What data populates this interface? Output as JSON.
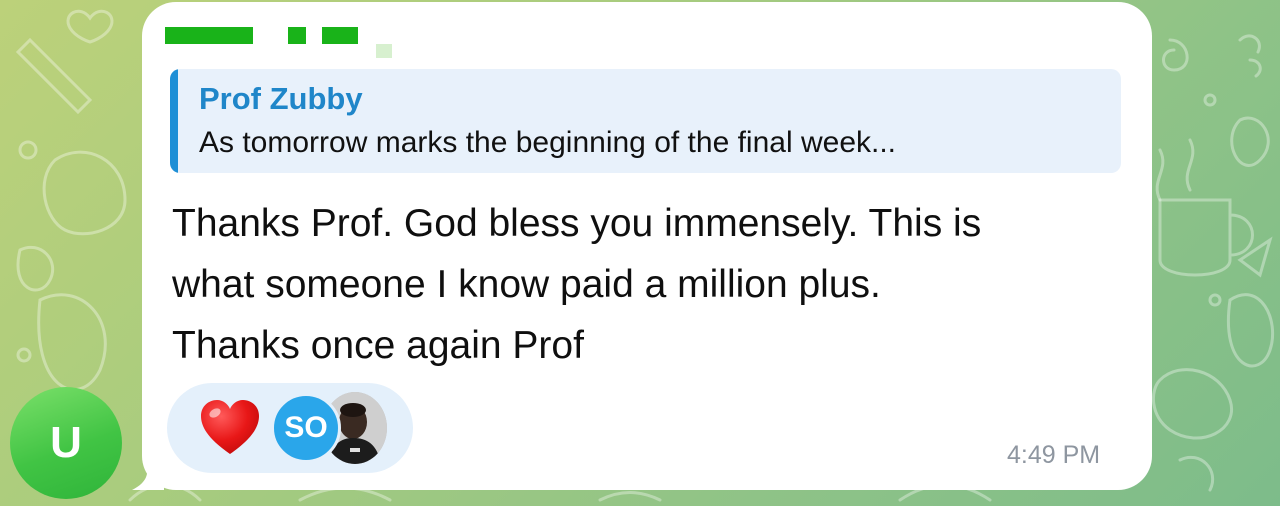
{
  "chat": {
    "reply": {
      "author": "Prof Zubby",
      "preview": "As tomorrow marks the beginning of the final week..."
    },
    "message": {
      "lines": [
        "Thanks Prof. God bless you immensely. This is",
        "what someone I know paid a million plus.",
        "Thanks once again Prof"
      ],
      "time": "4:49 PM"
    },
    "reactions": {
      "emoji": "heart",
      "reactor_initials": "SO"
    },
    "sender_avatar_initial": "U"
  },
  "colors": {
    "reply_accent": "#1e8fd6",
    "reaction_bg": "#e4f0fb",
    "so_avatar": "#2aa6ea",
    "user_avatar": "#41c444",
    "redaction_green": "#19b319"
  }
}
